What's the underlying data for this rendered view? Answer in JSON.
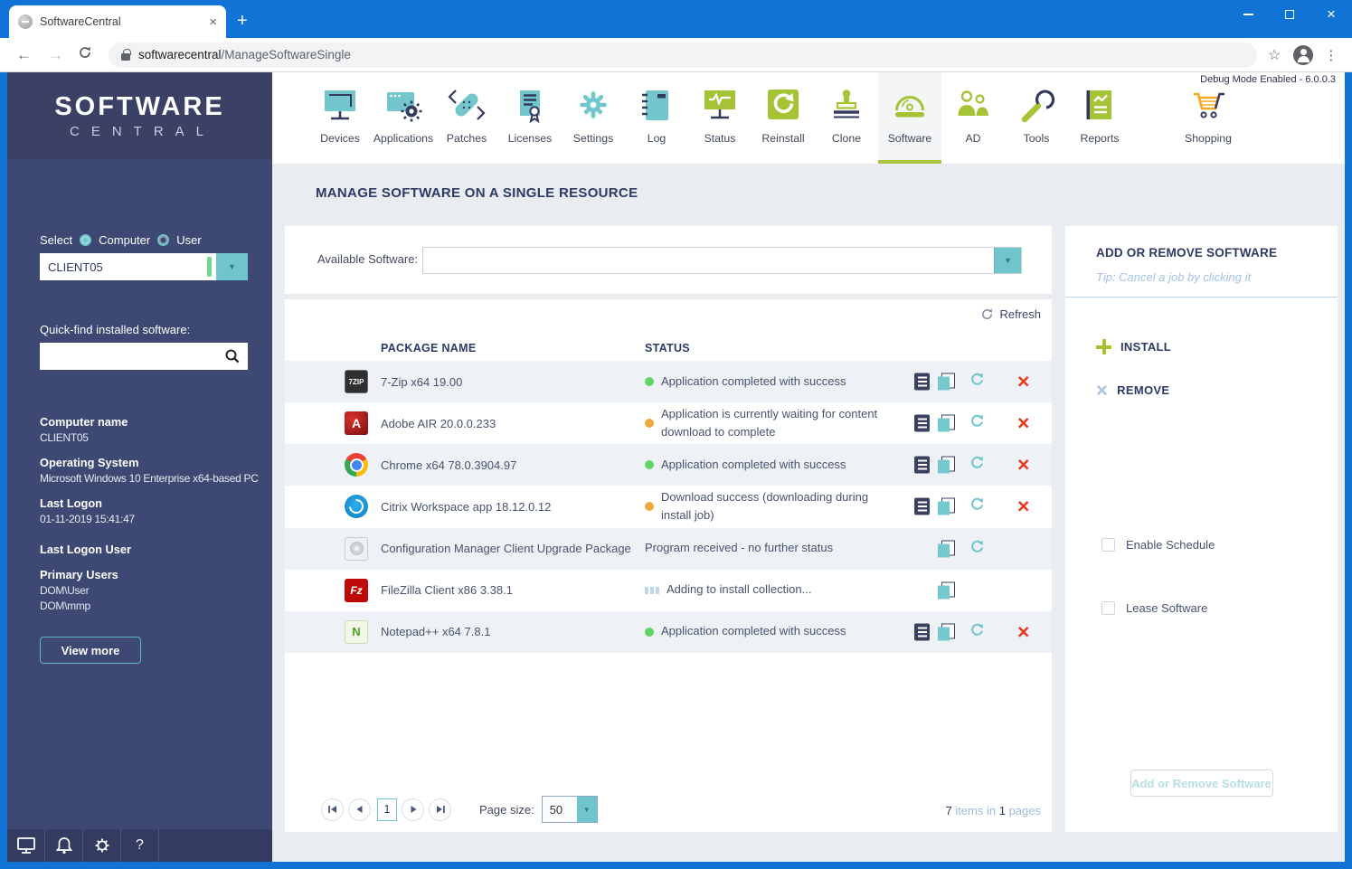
{
  "colors": {
    "titlebar_blue": "#1273d6",
    "accent_teal": "#6fc5cb",
    "accent_green": "#a6c432",
    "navy": "#2e3a66",
    "status_green": "#5fd663",
    "status_orange": "#f0a73c",
    "remove_red": "#e8391c"
  },
  "browser": {
    "tab_title": "SoftwareCentral",
    "url_host": "softwarecentral",
    "url_path": "/ManageSoftwareSingle"
  },
  "nav": {
    "debug_label": "Debug Mode Enabled - 6.0.0.3",
    "items": [
      {
        "label": "Devices",
        "icon": "devices-icon"
      },
      {
        "label": "Applications",
        "icon": "applications-icon"
      },
      {
        "label": "Patches",
        "icon": "patches-icon"
      },
      {
        "label": "Licenses",
        "icon": "licenses-icon"
      },
      {
        "label": "Settings",
        "icon": "settings-icon"
      },
      {
        "label": "Log",
        "icon": "log-icon"
      },
      {
        "label": "Status",
        "icon": "status-icon"
      },
      {
        "label": "Reinstall",
        "icon": "reinstall-icon"
      },
      {
        "label": "Clone",
        "icon": "clone-icon"
      },
      {
        "label": "Software",
        "icon": "software-icon",
        "active": true
      },
      {
        "label": "AD",
        "icon": "ad-icon"
      },
      {
        "label": "Tools",
        "icon": "tools-icon"
      },
      {
        "label": "Reports",
        "icon": "reports-icon"
      },
      {
        "label": "Shopping",
        "icon": "shopping-icon"
      }
    ]
  },
  "sidebar": {
    "logo_line1": "SOFTWARE",
    "logo_line2": "CENTRAL",
    "select_label": "Select",
    "radio_computer": "Computer",
    "radio_user": "User",
    "computer_select_value": "CLIENT05",
    "quickfind_label": "Quick-find installed software:",
    "computer_name_label": "Computer name",
    "computer_name": "CLIENT05",
    "os_label": "Operating System",
    "os": "Microsoft Windows 10 Enterprise x64-based PC",
    "last_logon_label": "Last Logon",
    "last_logon": "01-11-2019 15:41:47",
    "last_logon_user_label": "Last Logon User",
    "primary_users_label": "Primary Users",
    "primary_users": [
      "DOM\\User",
      "DOM\\mmp"
    ],
    "view_more_label": "View more"
  },
  "main": {
    "title": "MANAGE SOFTWARE ON A SINGLE RESOURCE",
    "available_software_label": "Available Software:",
    "available_software_value": "",
    "refresh_label": "Refresh",
    "table": {
      "columns": [
        "PACKAGE NAME",
        "STATUS"
      ],
      "rows": [
        {
          "icon": "7zip-app-icon",
          "name": "7-Zip x64 19.00",
          "status": "Application completed with success",
          "dot_color": "#5fd663",
          "actions": [
            "log",
            "copy",
            "refresh",
            "remove"
          ]
        },
        {
          "icon": "adobe-air-app-icon",
          "name": "Adobe AIR 20.0.0.233",
          "status": "Application is currently waiting for content download to complete",
          "dot_color": "#f0a73c",
          "actions": [
            "log",
            "copy",
            "refresh",
            "remove"
          ]
        },
        {
          "icon": "chrome-app-icon",
          "name": "Chrome x64 78.0.3904.97",
          "status": "Application completed with success",
          "dot_color": "#5fd663",
          "actions": [
            "log",
            "copy",
            "refresh",
            "remove"
          ]
        },
        {
          "icon": "citrix-app-icon",
          "name": "Citrix Workspace app 18.12.0.12",
          "status": "Download success (downloading during install job)",
          "dot_color": "#f0a73c",
          "actions": [
            "log",
            "copy",
            "refresh",
            "remove"
          ]
        },
        {
          "icon": "configmgr-app-icon",
          "name": "Configuration Manager Client Upgrade Package",
          "status": "Program received - no further status",
          "dot_color": "",
          "actions": [
            "copy",
            "refresh"
          ]
        },
        {
          "icon": "filezilla-app-icon",
          "name": "FileZilla Client x86 3.38.1",
          "status": "Adding to install collection...",
          "dot_color": "loading",
          "actions": [
            "copy"
          ]
        },
        {
          "icon": "notepadpp-app-icon",
          "name": "Notepad++ x64 7.8.1",
          "status": "Application completed with success",
          "dot_color": "#5fd663",
          "actions": [
            "log",
            "copy",
            "refresh",
            "remove"
          ]
        }
      ]
    },
    "pagination": {
      "current_page": "1",
      "page_size_label": "Page size:",
      "page_size_value": "50",
      "items_count": "7",
      "items_text": "items in",
      "pages_count": "1",
      "pages_text": "pages"
    }
  },
  "right_panel": {
    "title": "ADD OR REMOVE SOFTWARE",
    "tip": "Tip: Cancel a job by clicking it",
    "install_label": "INSTALL",
    "remove_label": "REMOVE",
    "enable_schedule_label": "Enable Schedule",
    "lease_software_label": "Lease Software",
    "submit_label": "Add or Remove Software"
  }
}
